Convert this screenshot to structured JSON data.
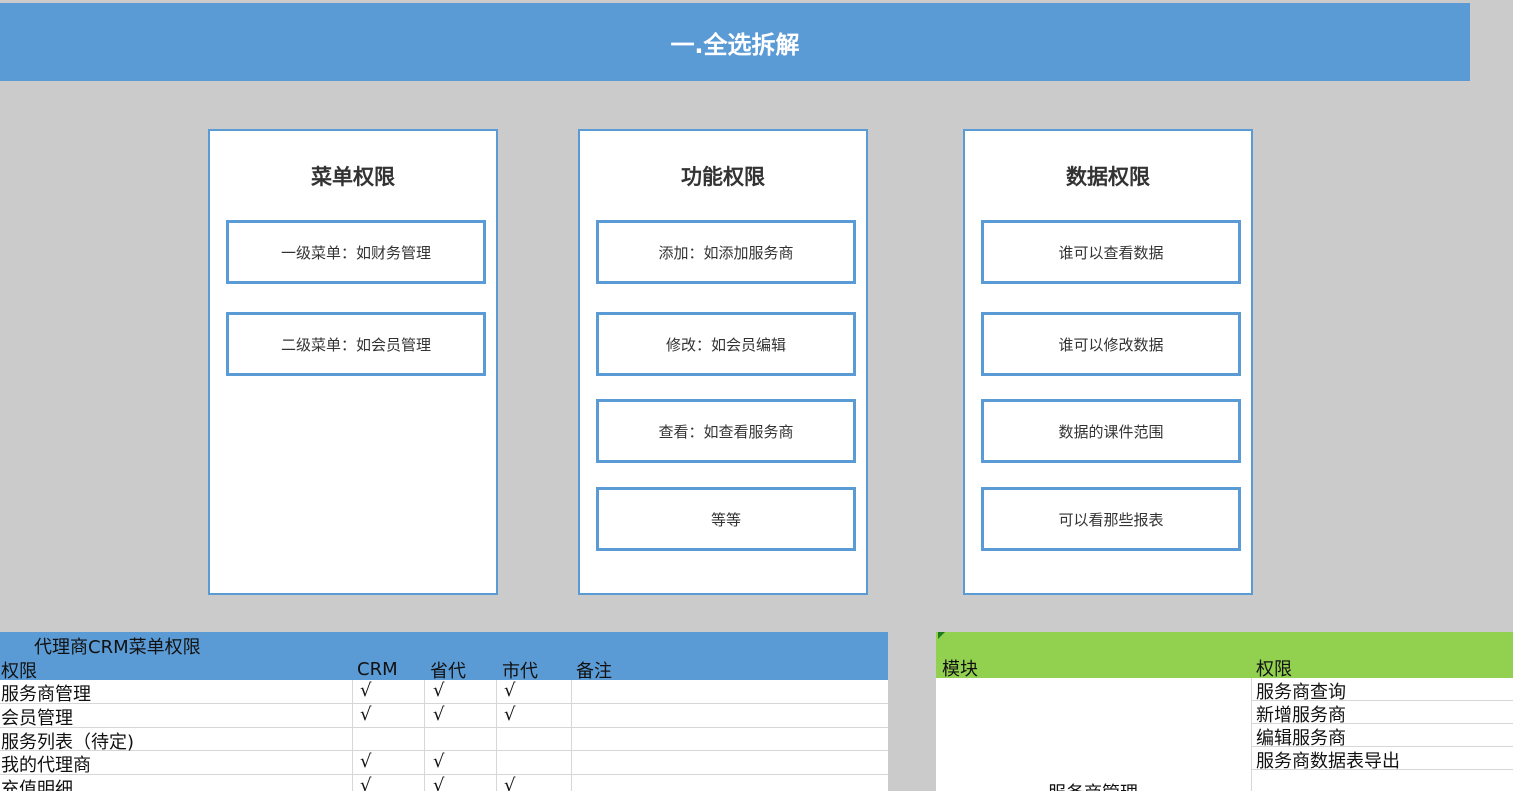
{
  "banner": {
    "title": "一.全选拆解"
  },
  "panels": [
    {
      "title": "菜单权限",
      "items": [
        "一级菜单：如财务管理",
        "二级菜单：如会员管理"
      ]
    },
    {
      "title": "功能权限",
      "items": [
        "添加：如添加服务商",
        "修改：如会员编辑",
        "查看：如查看服务商",
        "等等"
      ]
    },
    {
      "title": "数据权限",
      "items": [
        "谁可以查看数据",
        "谁可以修改数据",
        "数据的课件范围",
        "可以看那些报表"
      ]
    }
  ],
  "left_sheet": {
    "caption": "代理商CRM菜单权限",
    "headers": [
      "权限",
      "CRM",
      "省代",
      "市代",
      "备注"
    ],
    "rows": [
      [
        "服务商管理",
        "√",
        "√",
        "√",
        ""
      ],
      [
        "会员管理",
        "√",
        "√",
        "√",
        ""
      ],
      [
        "服务列表（待定)",
        "",
        "",
        "",
        ""
      ],
      [
        "我的代理商",
        "√",
        "√",
        "",
        ""
      ],
      [
        "充值明细",
        "√",
        "√",
        "√",
        ""
      ]
    ]
  },
  "right_sheet": {
    "headers": [
      "模块",
      "权限"
    ],
    "rows": [
      "服务商查询",
      "新增服务商",
      "编辑服务商",
      "服务商数据表导出"
    ],
    "module": "服务商管理"
  }
}
